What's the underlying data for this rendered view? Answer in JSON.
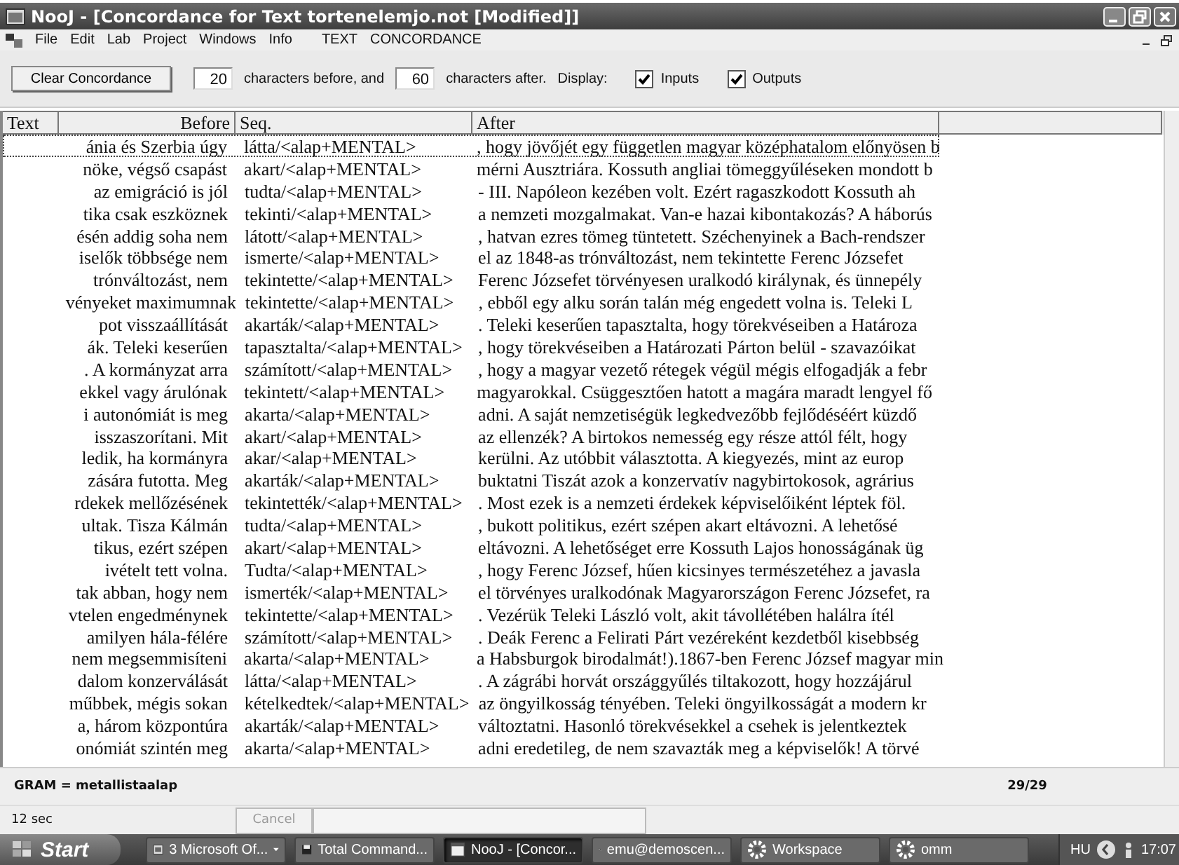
{
  "window": {
    "title": "NooJ - [Concordance for Text tortenelemjo.not [Modified]]"
  },
  "menu": [
    "File",
    "Edit",
    "Lab",
    "Project",
    "Windows",
    "Info",
    "TEXT",
    "CONCORDANCE"
  ],
  "toolbar": {
    "clear_button": "Clear Concordance",
    "before_count": "20",
    "before_label": "characters before, and",
    "after_count": "60",
    "after_label": "characters after.",
    "display_label": "Display:",
    "options": [
      {
        "label": "Inputs",
        "checked": true
      },
      {
        "label": "Outputs",
        "checked": true
      }
    ]
  },
  "table": {
    "columns": [
      "Text",
      "Before",
      "Seq.",
      "After"
    ],
    "rows": [
      {
        "before": "ánia és Szerbia úgy",
        "seq": "látta/<alap+MENTAL>",
        "after": ", hogy jövőjét egy független magyar középhatalom előnyösen b",
        "selected": true
      },
      {
        "before": "nöke, végső csapást",
        "seq": "akart/<alap+MENTAL>",
        "after": "mérni Ausztriára. Kossuth angliai tömeggyűléseken mondott b",
        "selected": false
      },
      {
        "before": "az emigráció is jól",
        "seq": "tudta/<alap+MENTAL>",
        "after": "- III. Napóleon kezében volt. Ezért ragaszkodott Kossuth ah",
        "selected": false
      },
      {
        "before": "tika csak eszköznek",
        "seq": "tekinti/<alap+MENTAL>",
        "after": "a nemzeti mozgalmakat. Van-e hazai kibontakozás? A háborús",
        "selected": false
      },
      {
        "before": "ésén addig soha nem",
        "seq": "látott/<alap+MENTAL>",
        "after": ", hatvan ezres tömeg tüntetett. Széchenyinek a Bach-rendszer",
        "selected": false
      },
      {
        "before": "iselők többsége nem",
        "seq": "ismerte/<alap+MENTAL>",
        "after": "el az 1848-as trónváltozást, nem tekintette Ferenc Józsefet",
        "selected": false
      },
      {
        "before": "trónváltozást, nem",
        "seq": "tekintette/<alap+MENTAL>",
        "after": "Ferenc Józsefet törvényesen uralkodó királynak, és ünnepély",
        "selected": false
      },
      {
        "before": "vényeket maximumnak",
        "seq": "tekintette/<alap+MENTAL>",
        "after": ", ebből egy alku során talán még engedett volna is. Teleki L",
        "selected": false
      },
      {
        "before": "pot visszaállítását",
        "seq": "akarták/<alap+MENTAL>",
        "after": ". Teleki keserűen tapasztalta, hogy törekvéseiben a Határoza",
        "selected": false
      },
      {
        "before": "ák. Teleki keserűen",
        "seq": "tapasztalta/<alap+MENTAL>",
        "after": ", hogy törekvéseiben a Határozati Párton belül - szavazóikat",
        "selected": false
      },
      {
        "before": ". A kormányzat arra",
        "seq": "számított/<alap+MENTAL>",
        "after": ", hogy a magyar vezető rétegek végül mégis elfogadják a febr",
        "selected": false
      },
      {
        "before": "ekkel vagy árulónak",
        "seq": "tekintett/<alap+MENTAL>",
        "after": "magyarokkal. Csüggesztően hatott a magára maradt lengyel fő",
        "selected": false
      },
      {
        "before": "i autonómiát is meg",
        "seq": "akarta/<alap+MENTAL>",
        "after": "adni. A saját nemzetiségük legkedvezőbb fejlődéséért küzdő",
        "selected": false
      },
      {
        "before": "isszaszorítani. Mit",
        "seq": "akart/<alap+MENTAL>",
        "after": "az ellenzék? A birtokos nemesség egy része attól félt, hogy",
        "selected": false
      },
      {
        "before": "ledik, ha kormányra",
        "seq": "akar/<alap+MENTAL>",
        "after": "kerülni. Az utóbbit választotta. A kiegyezés, mint az europ",
        "selected": false
      },
      {
        "before": "zására futotta. Meg",
        "seq": "akarták/<alap+MENTAL>",
        "after": "buktatni Tiszát azok a konzervatív nagybirtokosok, agrárius",
        "selected": false
      },
      {
        "before": "rdekek mellőzésének",
        "seq": "tekintették/<alap+MENTAL>",
        "after": ". Most ezek is a nemzeti érdekek képviselőiként léptek föl.",
        "selected": false
      },
      {
        "before": "ultak. Tisza Kálmán",
        "seq": "tudta/<alap+MENTAL>",
        "after": ", bukott politikus, ezért szépen akart eltávozni. A lehetősé",
        "selected": false
      },
      {
        "before": "tikus, ezért szépen",
        "seq": "akart/<alap+MENTAL>",
        "after": "eltávozni. A lehetőséget erre Kossuth Lajos honosságának üg",
        "selected": false
      },
      {
        "before": "ivételt tett volna.",
        "seq": "Tudta/<alap+MENTAL>",
        "after": ", hogy Ferenc József, hűen kicsinyes természetéhez a javasla",
        "selected": false
      },
      {
        "before": "tak abban, hogy nem",
        "seq": "ismerték/<alap+MENTAL>",
        "after": "el törvényes uralkodónak Magyarországon Ferenc Józsefet, ra",
        "selected": false
      },
      {
        "before": "vtelen engedménynek",
        "seq": "tekintette/<alap+MENTAL>",
        "after": ". Vezérük Teleki László volt, akit távollétében halálra ítél",
        "selected": false
      },
      {
        "before": "amilyen hála-félére",
        "seq": "számított/<alap+MENTAL>",
        "after": ". Deák Ferenc a Felirati Párt vezéreként kezdetből kisebbség",
        "selected": false
      },
      {
        "before": "nem megsemmisíteni",
        "seq": "akarta/<alap+MENTAL>",
        "after": "a Habsburgok birodalmát!).1867-ben Ferenc József magyar min",
        "selected": false
      },
      {
        "before": "dalom konzerválását",
        "seq": "látta/<alap+MENTAL>",
        "after": ". A zágrábi horvát országgyűlés tiltakozott, hogy hozzájárul",
        "selected": false
      },
      {
        "before": "műbbek, mégis sokan",
        "seq": "kételkedtek/<alap+MENTAL>",
        "after": "az öngyilkosság tényében. Teleki öngyilkosságát a modern kr",
        "selected": false
      },
      {
        "before": "a, három központúra",
        "seq": "akarták/<alap+MENTAL>",
        "after": "változtatni. Hasonló törekvésekkel a csehek is jelentkeztek",
        "selected": false
      },
      {
        "before": "onómiát szintén meg",
        "seq": "akarta/<alap+MENTAL>",
        "after": "adni eredetileg, de nem szavazták meg a képviselők! A törvé",
        "selected": false
      }
    ]
  },
  "footer": {
    "grammar": "GRAM = metallistaalap",
    "count": "29/29"
  },
  "status": {
    "time": "12 sec",
    "cancel": {
      "label": "Cancel",
      "disabled": true
    }
  },
  "taskbar": {
    "start": "Start",
    "tasks": [
      {
        "label": "3 Microsoft Of...",
        "kind": "group",
        "selected": false
      },
      {
        "label": "Total Command...",
        "kind": "disk",
        "selected": false
      },
      {
        "label": "NooJ - [Concor...",
        "kind": "window",
        "selected": true
      },
      {
        "label": "emu@demoscen...",
        "kind": "network",
        "selected": false
      },
      {
        "label": "Workspace",
        "kind": "gear",
        "selected": false
      },
      {
        "label": "omm",
        "kind": "gear",
        "selected": false
      }
    ],
    "language": "HU",
    "clock": "17:07"
  }
}
